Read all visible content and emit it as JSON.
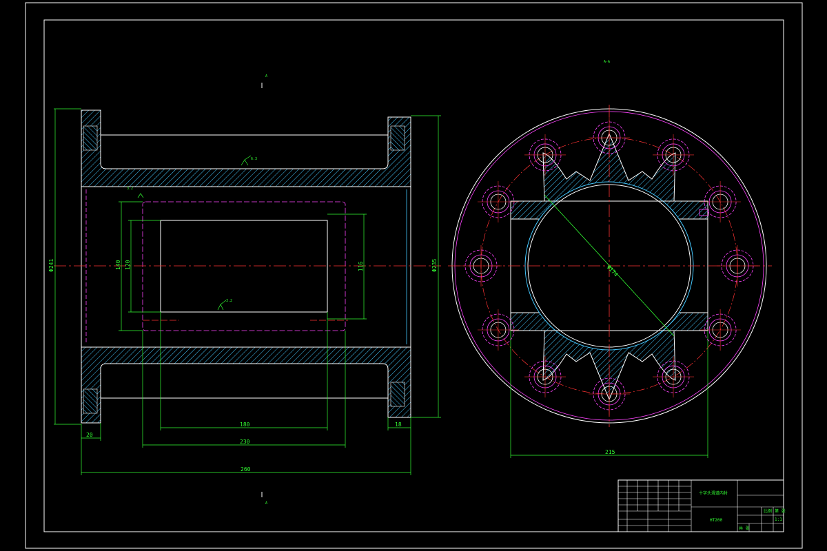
{
  "colors": {
    "background": "#000000",
    "outline": "#ffffff",
    "hatch": "#44c8ff",
    "dimension": "#33ff33",
    "centerline": "#ff3333",
    "hidden": "#ff44ff"
  },
  "dimensions": {
    "left_overall_dia": "Φ241",
    "right_flange_dia": "Φ235",
    "bore_outer": "140",
    "bore_inner": "120",
    "bore_right": "116",
    "shaft_180": "180",
    "shaft_230": "230",
    "overall_length": "260",
    "left_flange_thk": "20",
    "right_flange_thk": "18",
    "end_view_width": "215",
    "end_view_dia": "Φ174"
  },
  "markers": {
    "section_top": "A",
    "section_bottom": "A",
    "view_label": "A-A",
    "roughness_1": "6.3",
    "roughness_2": "3.2",
    "roughness_3": "3.2"
  },
  "title_block": {
    "part_name": "十字头滑道内衬",
    "material": "HT200",
    "scale_label": "比例",
    "sheet_label": "第 张",
    "scale_value": "1:1",
    "sheet_count": "共 张"
  }
}
